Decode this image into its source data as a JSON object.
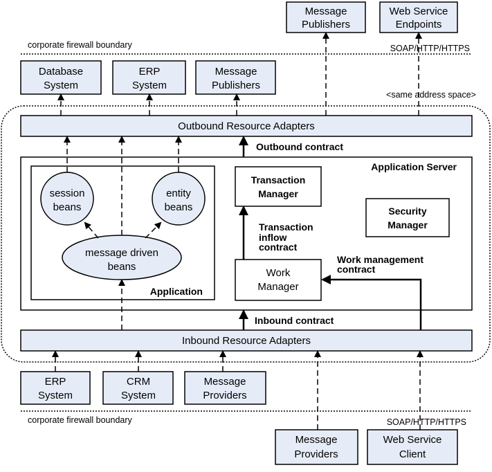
{
  "top_boxes": [
    {
      "line1": "Message",
      "line2": "Publishers"
    },
    {
      "line1": "Web Service",
      "line2": "Endpoints"
    }
  ],
  "firewall_top": {
    "label": "corporate firewall boundary",
    "protocol": "SOAP/HTTP/HTTPS"
  },
  "outbound_targets": [
    {
      "line1": "Database",
      "line2": "System"
    },
    {
      "line1": "ERP",
      "line2": "System"
    },
    {
      "line1": "Message",
      "line2": "Publishers"
    }
  ],
  "address_space_label": "<same address space>",
  "outbound_adapters": "Outbound Resource Adapters",
  "outbound_contract": "Outbound contract",
  "app_server": {
    "title": "Application Server",
    "application": {
      "title": "Application",
      "session_beans": {
        "line1": "session",
        "line2": "beans"
      },
      "entity_beans": {
        "line1": "entity",
        "line2": "beans"
      },
      "mdb": {
        "line1": "message driven",
        "line2": "beans"
      }
    },
    "transaction_manager": {
      "line1": "Transaction",
      "line2": "Manager"
    },
    "security_manager": {
      "line1": "Security",
      "line2": "Manager"
    },
    "work_manager": {
      "line1": "Work",
      "line2": "Manager"
    },
    "transaction_inflow": {
      "line1": "Transaction",
      "line2": "inflow",
      "line3": "contract"
    },
    "work_management": {
      "line1": "Work management",
      "line2": "contract"
    }
  },
  "inbound_contract": "Inbound contract",
  "inbound_adapters": "Inbound Resource Adapters",
  "inbound_sources": [
    {
      "line1": "ERP",
      "line2": "System"
    },
    {
      "line1": "CRM",
      "line2": "System"
    },
    {
      "line1": "Message",
      "line2": "Providers"
    }
  ],
  "firewall_bottom": {
    "label": "corporate firewall boundary",
    "protocol": "SOAP/HTTP/HTTPS"
  },
  "bottom_boxes": [
    {
      "line1": "Message",
      "line2": "Providers"
    },
    {
      "line1": "Web Service",
      "line2": "Client"
    }
  ],
  "colors": {
    "box_fill": "#e6ecf7",
    "stroke": "#000000"
  }
}
